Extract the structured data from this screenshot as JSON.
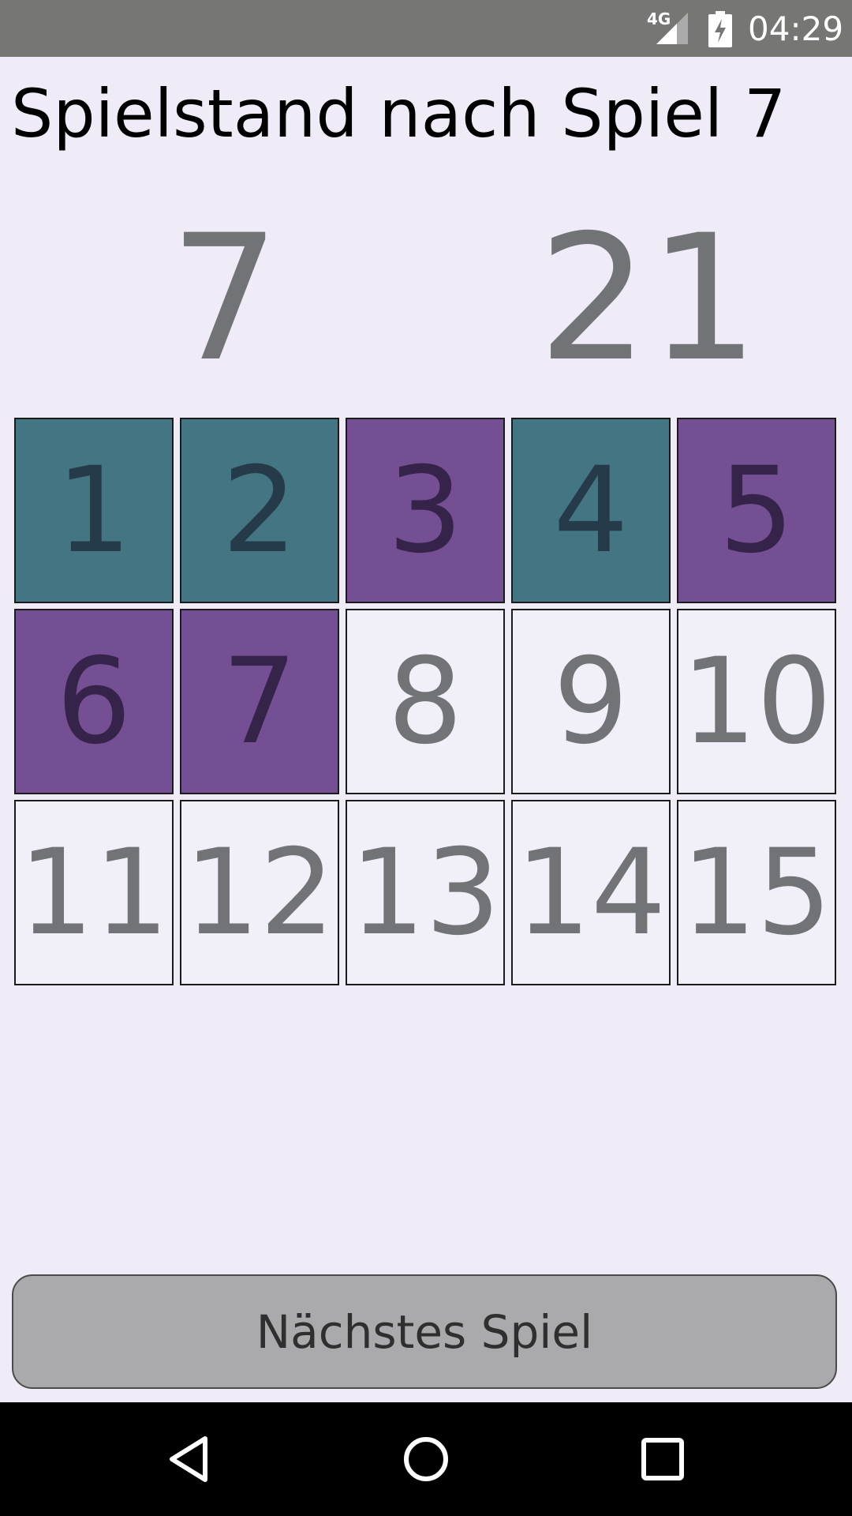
{
  "status_bar": {
    "network": "4G",
    "time": "04:29",
    "icons": [
      "signal-icon",
      "battery-charging-icon"
    ]
  },
  "title": "Spielstand nach Spiel 7",
  "scores": {
    "left": "7",
    "right": "21"
  },
  "colors": {
    "team_a": "#447583",
    "team_b": "#754f93",
    "empty": "#f1eff8"
  },
  "tiles": [
    {
      "label": "1",
      "owner": "team_a"
    },
    {
      "label": "2",
      "owner": "team_a"
    },
    {
      "label": "3",
      "owner": "team_b"
    },
    {
      "label": "4",
      "owner": "team_a"
    },
    {
      "label": "5",
      "owner": "team_b"
    },
    {
      "label": "6",
      "owner": "team_b"
    },
    {
      "label": "7",
      "owner": "team_b"
    },
    {
      "label": "8",
      "owner": "none"
    },
    {
      "label": "9",
      "owner": "none"
    },
    {
      "label": "10",
      "owner": "none"
    },
    {
      "label": "11",
      "owner": "none"
    },
    {
      "label": "12",
      "owner": "none"
    },
    {
      "label": "13",
      "owner": "none"
    },
    {
      "label": "14",
      "owner": "none"
    },
    {
      "label": "15",
      "owner": "none"
    }
  ],
  "next_button": "Nächstes Spiel",
  "nav_bar": {
    "icons": [
      "back-icon",
      "home-icon",
      "recents-icon"
    ]
  }
}
